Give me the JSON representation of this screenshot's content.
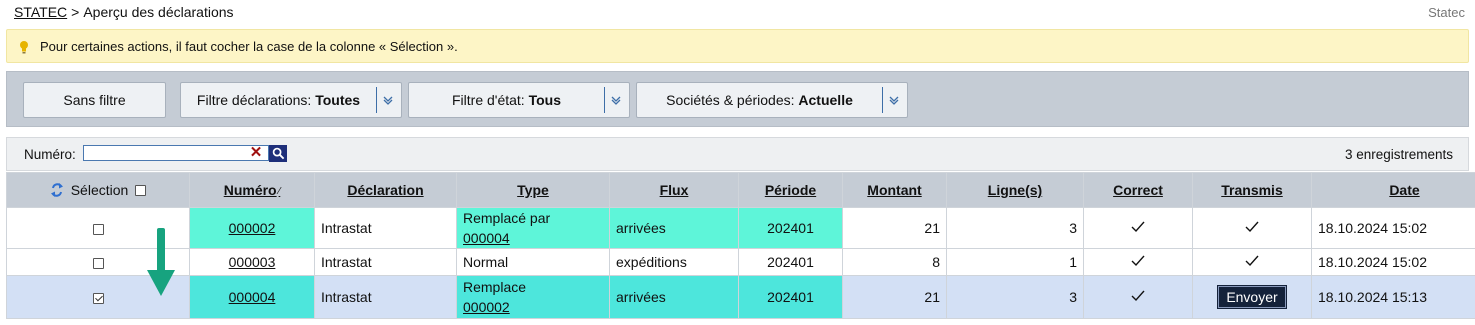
{
  "breadcrumb": {
    "root": "STATEC",
    "separator": ">",
    "current": "Aperçu des déclarations"
  },
  "brand": "Statec",
  "hint": {
    "icon": "lightbulb-icon",
    "text": "Pour certaines actions, il faut cocher la case de la colonne « Sélection »."
  },
  "filters": {
    "no_filter": "Sans filtre",
    "declarations": {
      "label": "Filtre déclarations:",
      "value": "Toutes"
    },
    "state": {
      "label": "Filtre d'état:",
      "value": "Tous"
    },
    "companies": {
      "label": "Sociétés & périodes:",
      "value": "Actuelle"
    }
  },
  "search": {
    "label": "Numéro:",
    "value": "",
    "clear": "✕"
  },
  "records": "3 enregistrements",
  "table": {
    "headers": {
      "selection": "Sélection",
      "numero": "Numéro",
      "sort": "⁄",
      "declaration": "Déclaration",
      "type": "Type",
      "flux": "Flux",
      "periode": "Période",
      "montant": "Montant",
      "lignes": "Ligne(s)",
      "correct": "Correct",
      "transmis": "Transmis",
      "date": "Date"
    },
    "rows": [
      {
        "selected": false,
        "numero": "000002",
        "declaration": "Intrastat",
        "type": "Remplacé par",
        "type_ref": "000004",
        "flux": "arrivées",
        "periode": "202401",
        "montant": "21",
        "lignes": "3",
        "correct": true,
        "transmis": true,
        "date": "18.10.2024 15:02"
      },
      {
        "selected": false,
        "numero": "000003",
        "declaration": "Intrastat",
        "type": "Normal",
        "type_ref": "",
        "flux": "expéditions",
        "periode": "202401",
        "montant": "8",
        "lignes": "1",
        "correct": true,
        "transmis": true,
        "date": "18.10.2024 15:02"
      },
      {
        "selected": true,
        "numero": "000004",
        "declaration": "Intrastat",
        "type": "Remplace",
        "type_ref": "000002",
        "flux": "arrivées",
        "periode": "202401",
        "montant": "21",
        "lignes": "3",
        "correct": true,
        "transmis": false,
        "action": "Envoyer",
        "date": "18.10.2024 15:13"
      }
    ]
  },
  "colors": {
    "teal_replaced": "#5ef5d9",
    "teal_replace": "#4de6dc",
    "selected_row": "#d3e0f5",
    "arrow": "#17a37f"
  }
}
